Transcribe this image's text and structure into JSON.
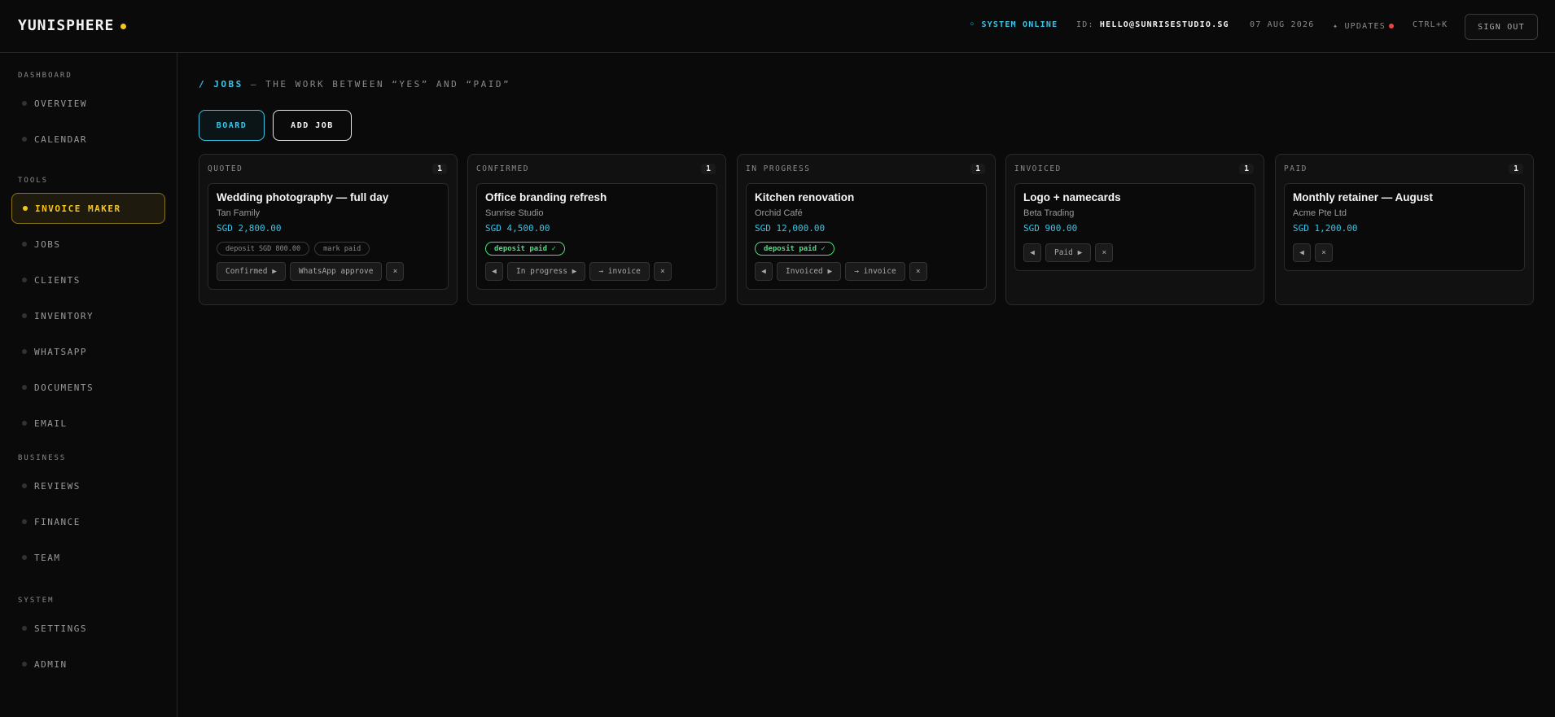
{
  "header": {
    "logo": "YUNISPHERE",
    "status": "◦ SYSTEM ONLINE",
    "id_label": "ID:",
    "id_value": "HELLO@SUNRISESTUDIO.SG",
    "date": "07 AUG 2026",
    "updates": "✦ UPDATES",
    "shortcut": "CTRL+K",
    "sign_out": "SIGN OUT"
  },
  "sidebar": {
    "sections": [
      {
        "label": "DASHBOARD",
        "items": [
          "OVERVIEW",
          "CALENDAR"
        ]
      },
      {
        "label": "TOOLS",
        "items": [
          "INVOICE MAKER",
          "JOBS",
          "CLIENTS",
          "INVENTORY",
          "WHATSAPP",
          "DOCUMENTS",
          "EMAIL"
        ]
      },
      {
        "label": "BUSINESS",
        "items": [
          "REVIEWS",
          "FINANCE",
          "TEAM"
        ]
      },
      {
        "label": "SYSTEM",
        "items": [
          "SETTINGS",
          "ADMIN"
        ]
      }
    ],
    "active_item": "INVOICE MAKER"
  },
  "main": {
    "breadcrumb_accent": "/ JOBS",
    "breadcrumb_rest": " — THE WORK BETWEEN “YES” AND “PAID”",
    "board_button": "BOARD",
    "add_button": "ADD JOB",
    "columns": [
      {
        "name": "QUOTED",
        "count": "1",
        "card": {
          "title": "Wedding photography — full day",
          "client": "Tan Family",
          "amount": "SGD 2,800.00",
          "chips": [
            {
              "text": "deposit SGD 800.00",
              "ok": false
            },
            {
              "text": "mark paid",
              "ok": false
            }
          ],
          "actions": [
            "Confirmed ▶",
            "WhatsApp approve",
            "×"
          ]
        }
      },
      {
        "name": "CONFIRMED",
        "count": "1",
        "card": {
          "title": "Office branding refresh",
          "client": "Sunrise Studio",
          "amount": "SGD 4,500.00",
          "chips": [
            {
              "text": "deposit paid ✓",
              "ok": true
            }
          ],
          "actions": [
            "◀",
            "In progress ▶",
            "→ invoice",
            "×"
          ]
        }
      },
      {
        "name": "IN PROGRESS",
        "count": "1",
        "card": {
          "title": "Kitchen renovation",
          "client": "Orchid Café",
          "amount": "SGD 12,000.00",
          "chips": [
            {
              "text": "deposit paid ✓",
              "ok": true
            }
          ],
          "actions": [
            "◀",
            "Invoiced ▶",
            "→ invoice",
            "×"
          ]
        }
      },
      {
        "name": "INVOICED",
        "count": "1",
        "card": {
          "title": "Logo + namecards",
          "client": "Beta Trading",
          "amount": "SGD 900.00",
          "chips": [],
          "actions": [
            "◀",
            "Paid ▶",
            "×"
          ]
        }
      },
      {
        "name": "PAID",
        "count": "1",
        "card": {
          "title": "Monthly retainer — August",
          "client": "Acme Pte Ltd",
          "amount": "SGD 1,200.00",
          "chips": [],
          "actions": [
            "◀",
            "×"
          ]
        }
      }
    ]
  },
  "colors": {
    "accent_cyan": "#38c5e8",
    "accent_yellow": "#f5c518",
    "success_green": "#4ade80",
    "alert_red": "#ef4444"
  }
}
